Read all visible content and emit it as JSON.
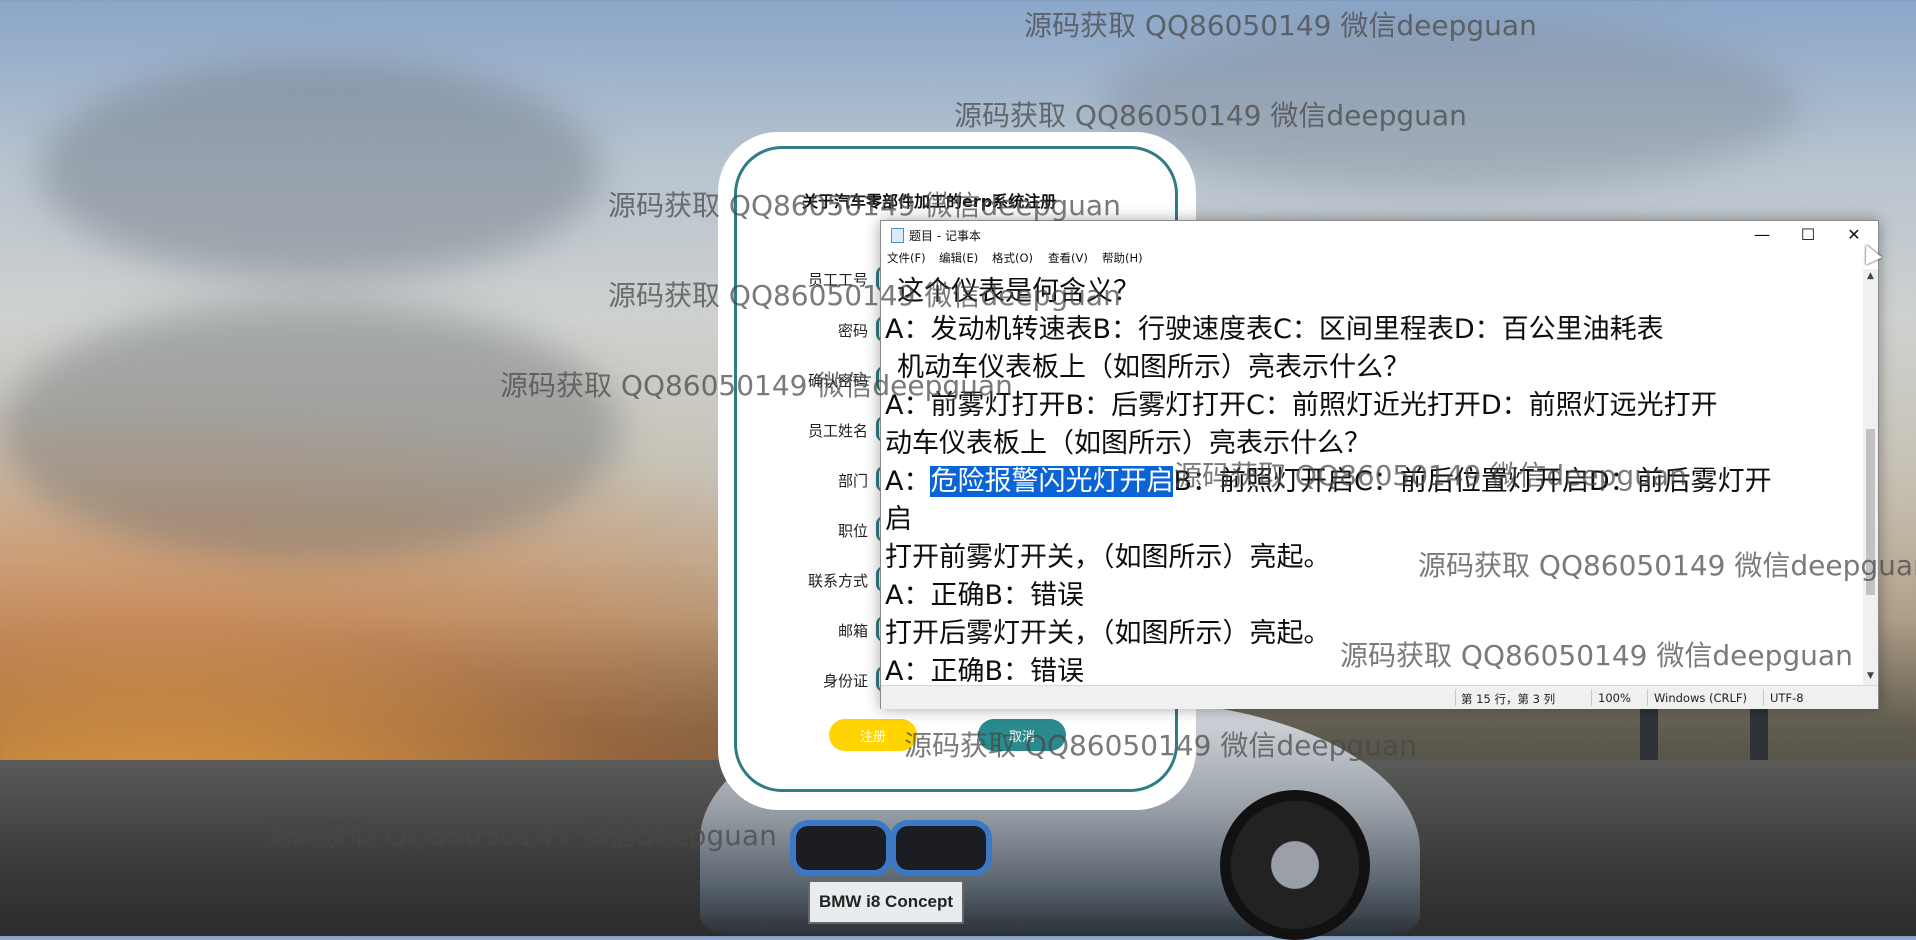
{
  "register_form": {
    "title": "关于汽车零部件加工的erp系统注册",
    "fields": [
      {
        "label": "员工工号"
      },
      {
        "label": "密码"
      },
      {
        "label": "确认密码"
      },
      {
        "label": "员工姓名"
      },
      {
        "label": "部门"
      },
      {
        "label": "职位"
      },
      {
        "label": "联系方式"
      },
      {
        "label": "邮箱"
      },
      {
        "label": "身份证"
      }
    ],
    "register_label": "注册",
    "cancel_label": "取消",
    "accent_color": "#2f7d83",
    "register_color": "#ffd400",
    "cancel_color": "#2a8a8e"
  },
  "notepad": {
    "title": "题目 - 记事本",
    "icon": "notepad-icon",
    "controls": {
      "minimize": "—",
      "maximize": "☐",
      "close": "✕"
    },
    "menu": [
      "文件(F)",
      "编辑(E)",
      "格式(O)",
      "查看(V)",
      "帮助(H)"
    ],
    "lines": [
      "这个仪表是何含义？",
      "A：发动机转速表B：行驶速度表C：区间里程表D：百公里油耗表",
      "机动车仪表板上（如图所示）亮表示什么？",
      "A：前雾灯打开B：后雾灯打开C：前照灯近光打开D：前照灯远光打开",
      "动车仪表板上（如图所示）亮表示什么？",
      {
        "prefix": "A：",
        "highlight": "危险报警闪光灯开启",
        "suffix": "B：前照灯开启C：前后位置灯开启D：前后雾灯开"
      },
      "启",
      "打开前雾灯开关，（如图所示）亮起。",
      "A：正确B：错误",
      "打开后雾灯开关，（如图所示）亮起。",
      "A：正确B：错误"
    ],
    "status": {
      "position": "第 15 行，第 3 列",
      "zoom": "100%",
      "line_ending": "Windows (CRLF)",
      "encoding": "UTF-8"
    },
    "highlight_color": "#0a64d6"
  },
  "watermark_text": "源码获取 QQ86050149 微信deepguan",
  "car_plate": "BMW i8 Concept"
}
